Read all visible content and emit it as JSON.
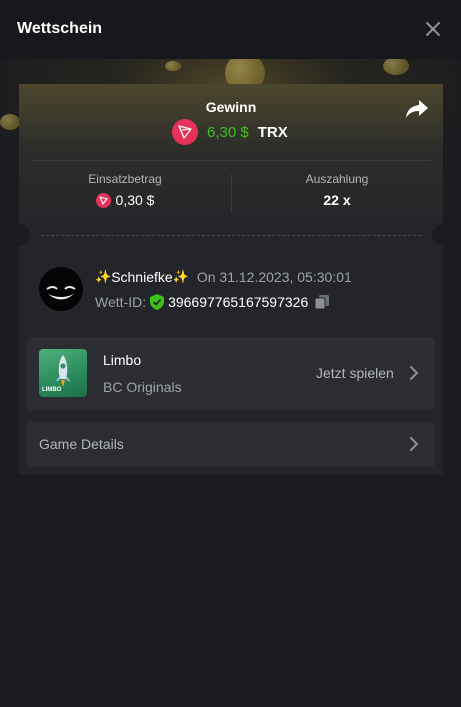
{
  "header": {
    "title": "Wettschein"
  },
  "win": {
    "label": "Gewinn",
    "amount": "6,30 $",
    "currency": "TRX"
  },
  "stake": {
    "label": "Einsatzbetrag",
    "value": "0,30 $"
  },
  "payout": {
    "label": "Auszahlung",
    "value": "22 x"
  },
  "user": {
    "spark_left": "✨",
    "name": "Schniefke",
    "spark_right": "✨",
    "date": "On 31.12.2023, 05:30:01"
  },
  "bet": {
    "id_label": "Wett-ID:",
    "id": "396697765167597326"
  },
  "game": {
    "name": "Limbo",
    "provider": "BC Originals",
    "play_label": "Jetzt spielen",
    "thumb_text": "LIMBO"
  },
  "details": {
    "label": "Game Details"
  },
  "colors": {
    "accent_green": "#3bc117",
    "trx_red": "#e4335a",
    "background": "#1b1c1f",
    "card": "#23252a"
  },
  "icons": [
    "close-icon",
    "share-icon",
    "trx-coin-icon",
    "verified-shield-icon",
    "copy-icon",
    "chevron-right-icon"
  ]
}
